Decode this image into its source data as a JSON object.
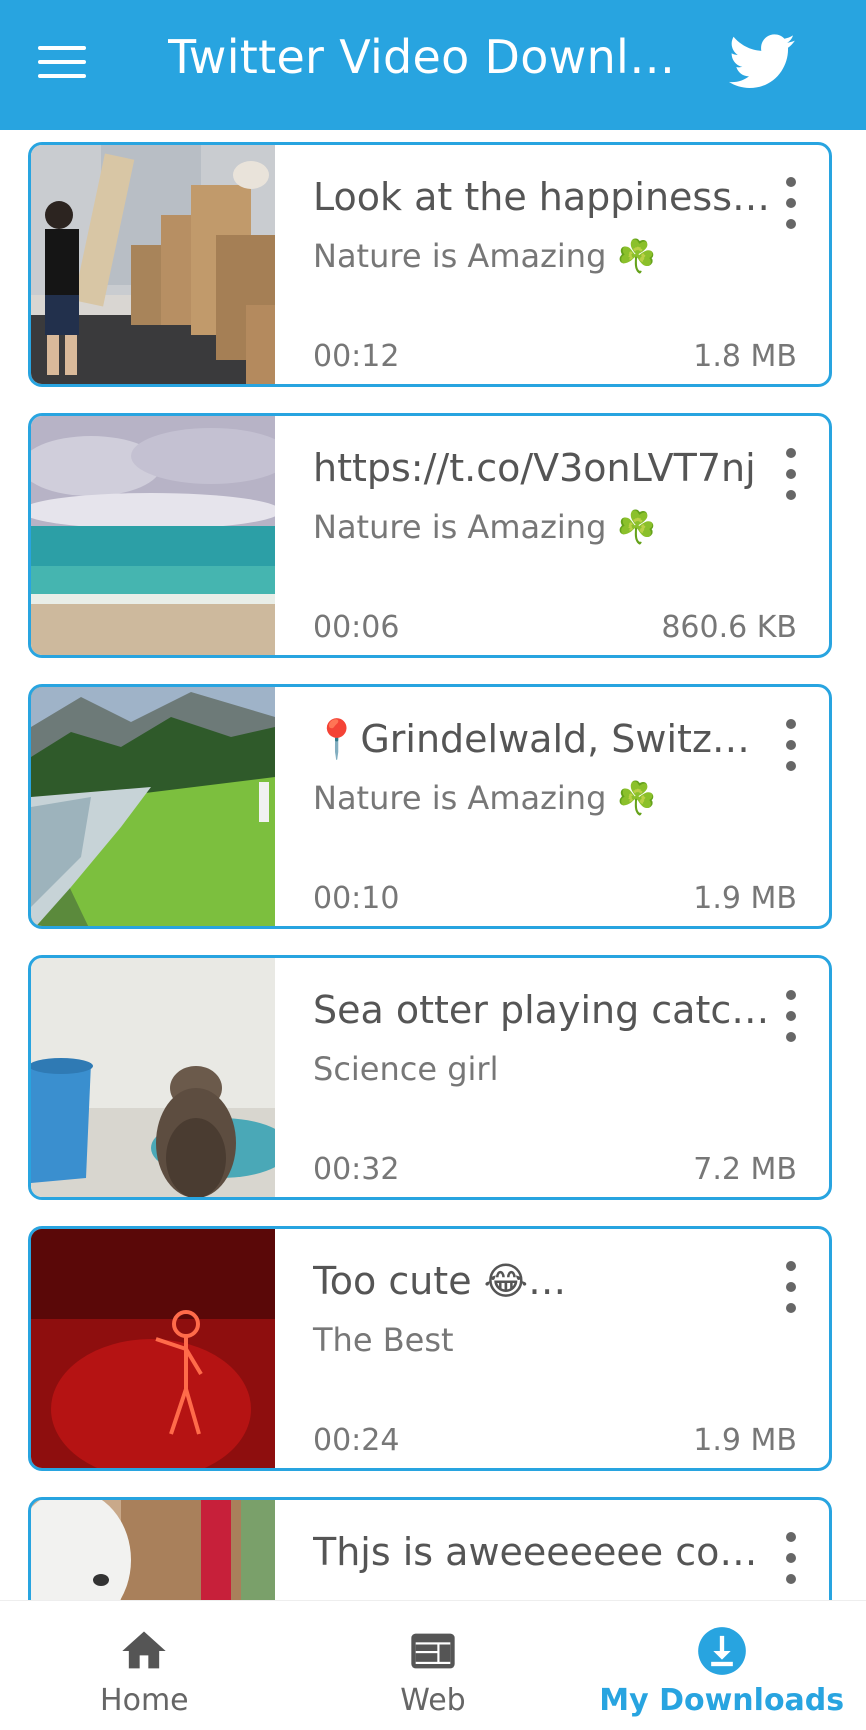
{
  "header": {
    "title": "Twitter Video Downl…",
    "menu_icon": "hamburger-menu-icon",
    "brand_icon": "twitter-bird-icon",
    "background": "#28a4e0"
  },
  "downloads": [
    {
      "title": "Look at the happiness…",
      "subtitle": "Nature is Amazing",
      "subtitle_emoji": "☘️",
      "duration": "00:12",
      "size": "1.8 MB"
    },
    {
      "title": "https://t.co/V3onLVT7nj",
      "subtitle": "Nature is Amazing",
      "subtitle_emoji": "☘️",
      "duration": "00:06",
      "size": "860.6 KB"
    },
    {
      "title": "📍Grindelwald, Switz…",
      "subtitle": "Nature is Amazing",
      "subtitle_emoji": "☘️",
      "duration": "00:10",
      "size": "1.9 MB"
    },
    {
      "title": "Sea otter playing catc…",
      "subtitle": "Science girl",
      "subtitle_emoji": "",
      "duration": "00:32",
      "size": "7.2 MB"
    },
    {
      "title": "Too cute 😂…",
      "subtitle": "The Best",
      "subtitle_emoji": "",
      "duration": "00:24",
      "size": "1.9 MB"
    },
    {
      "title": "Thjs is aweeeeeee con…",
      "subtitle": "",
      "subtitle_emoji": "",
      "duration": "",
      "size": ""
    }
  ],
  "bottom_nav": {
    "home": {
      "label": "Home",
      "icon": "home-icon"
    },
    "web": {
      "label": "Web",
      "icon": "browser-window-icon"
    },
    "downloads": {
      "label": "My Downloads",
      "icon": "download-circle-icon",
      "active": true
    }
  },
  "accent_color": "#28a4e0"
}
